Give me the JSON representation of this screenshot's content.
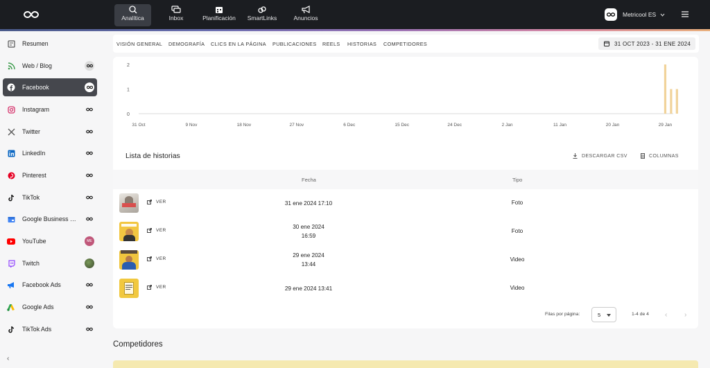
{
  "topnav": {
    "items": [
      {
        "label": "Analítica",
        "icon": "analytics-icon",
        "active": true
      },
      {
        "label": "Inbox",
        "icon": "inbox-icon"
      },
      {
        "label": "Planificación",
        "icon": "calendar-icon"
      },
      {
        "label": "SmartLinks",
        "icon": "link-icon"
      },
      {
        "label": "Anuncios",
        "icon": "megaphone-icon"
      }
    ],
    "account": "Metricool ES"
  },
  "sidebar": {
    "items": [
      {
        "label": "Resumen",
        "icon": "summary-icon"
      },
      {
        "label": "Web / Blog",
        "icon": "rss-icon"
      },
      {
        "label": "Facebook",
        "icon": "facebook-icon",
        "active": true
      },
      {
        "label": "Instagram",
        "icon": "instagram-icon"
      },
      {
        "label": "Twitter",
        "icon": "x-icon"
      },
      {
        "label": "LinkedIn",
        "icon": "linkedin-icon"
      },
      {
        "label": "Pinterest",
        "icon": "pinterest-icon"
      },
      {
        "label": "TikTok",
        "icon": "tiktok-icon"
      },
      {
        "label": "Google Business …",
        "icon": "google-business-icon"
      },
      {
        "label": "YouTube",
        "icon": "youtube-icon",
        "badge": "ME"
      },
      {
        "label": "Twitch",
        "icon": "twitch-icon"
      },
      {
        "label": "Facebook Ads",
        "icon": "ads-megaphone-icon"
      },
      {
        "label": "Google Ads",
        "icon": "google-ads-icon"
      },
      {
        "label": "TikTok Ads",
        "icon": "tiktok-icon"
      }
    ]
  },
  "subnav": {
    "tabs": [
      "Visión general",
      "Demografía",
      "Clics en la página",
      "Publicaciones",
      "Reels",
      "Historias",
      "Competidores"
    ],
    "date_range": "31 OCT 2023 - 31 ENE 2024"
  },
  "chart_data": {
    "type": "bar",
    "x_tick_labels": [
      "31 Oct",
      "9 Nov",
      "18 Nov",
      "27 Nov",
      "6 Dec",
      "15 Dec",
      "24 Dec",
      "2 Jan",
      "11 Jan",
      "20 Jan",
      "29 Jan"
    ],
    "y_tick_labels": [
      "0",
      "1",
      "2"
    ],
    "ylim": [
      0,
      2
    ],
    "bars": [
      {
        "date": "29 Jan",
        "value": 2
      },
      {
        "date": "30 Jan",
        "value": 1
      },
      {
        "date": "31 Jan",
        "value": 1
      }
    ],
    "color": "#f1d39a"
  },
  "stories": {
    "title": "Lista de historias",
    "download_csv": "DESCARGAR CSV",
    "columns_btn": "COLUMNAS",
    "headers": {
      "date": "Fecha",
      "type": "Tipo"
    },
    "view_label": "VER",
    "rows": [
      {
        "date": "31 ene 2024 17:10",
        "type": "Foto"
      },
      {
        "date_line1": "30 ene 2024",
        "date_line2": "16:59",
        "type": "Foto"
      },
      {
        "date_line1": "29 ene 2024",
        "date_line2": "13:44",
        "type": "Video"
      },
      {
        "date": "29 ene 2024 13:41",
        "type": "Video"
      }
    ],
    "pagination": {
      "rows_per_page_label": "Filas por página:",
      "rows_per_page": "5",
      "range": "1-4 de 4"
    }
  },
  "competitors_title": "Competidores"
}
